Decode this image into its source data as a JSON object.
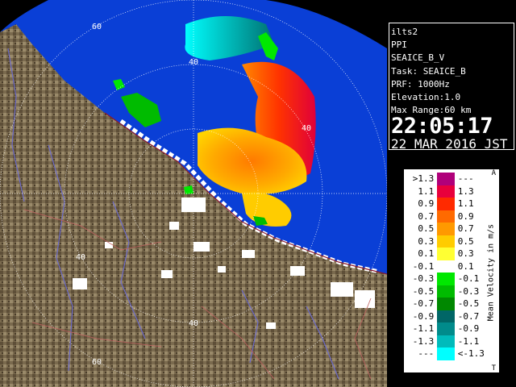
{
  "info": {
    "radar_name": "ilts2",
    "product": "PPI",
    "product_param": "SEAICE_B_V",
    "task": "Task: SEAICE_B",
    "prf": "PRF: 1000Hz",
    "elevation": "Elevation:1.0",
    "max_range": "Max Range:60 km",
    "time": "22:05:17",
    "date": "22 MAR 2016 JST"
  },
  "range_rings": {
    "labels": [
      "60",
      "40",
      "40",
      "40",
      "40",
      "60"
    ]
  },
  "legend": {
    "title": "Mean Velocity in m/s",
    "arrow_top": "A",
    "arrow_bottom": "T",
    "rows": [
      {
        "lo": ">1.3",
        "hi": "---",
        "color": "#b0007a"
      },
      {
        "lo": "1.1",
        "hi": "1.3",
        "color": "#e8003c"
      },
      {
        "lo": "0.9",
        "hi": "1.1",
        "color": "#ff2a00"
      },
      {
        "lo": "0.7",
        "hi": "0.9",
        "color": "#ff6a00"
      },
      {
        "lo": "0.5",
        "hi": "0.7",
        "color": "#ff9900"
      },
      {
        "lo": "0.3",
        "hi": "0.5",
        "color": "#ffcc00"
      },
      {
        "lo": "0.1",
        "hi": "0.3",
        "color": "#ffff33"
      },
      {
        "lo": "-0.1",
        "hi": "0.1",
        "color": "#ffffff"
      },
      {
        "lo": "-0.3",
        "hi": "-0.1",
        "color": "#00e800"
      },
      {
        "lo": "-0.5",
        "hi": "-0.3",
        "color": "#00bb00"
      },
      {
        "lo": "-0.7",
        "hi": "-0.5",
        "color": "#008800"
      },
      {
        "lo": "-0.9",
        "hi": "-0.7",
        "color": "#006666"
      },
      {
        "lo": "-1.1",
        "hi": "-0.9",
        "color": "#008b8b"
      },
      {
        "lo": "-1.3",
        "hi": "-1.1",
        "color": "#00bbbb"
      },
      {
        "lo": "---",
        "hi": "<-1.3",
        "color": "#00ffff"
      }
    ]
  },
  "colors": {
    "sea": "#0a3fd6",
    "land": "#7a6a4e",
    "background": "#000000"
  }
}
